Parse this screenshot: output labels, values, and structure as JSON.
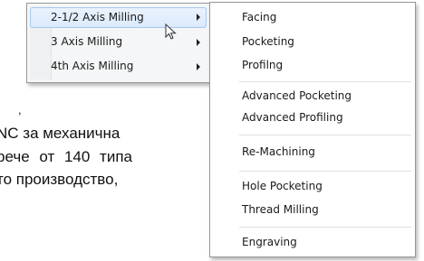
{
  "document": {
    "lines": [
      ",",
      "NC за механична",
      "рече от 140 типа",
      "то производство,"
    ]
  },
  "menu_left": {
    "items": [
      {
        "label": "2-1/2 Axis Milling",
        "has_submenu": true,
        "highlighted": true
      },
      {
        "label": "3 Axis Milling",
        "has_submenu": true,
        "highlighted": false
      },
      {
        "label": "4th Axis Milling",
        "has_submenu": true,
        "highlighted": false
      }
    ]
  },
  "menu_right": {
    "items": [
      {
        "label": "Facing"
      },
      {
        "label": "Pocketing"
      },
      {
        "label": "Profilng"
      },
      {
        "label": "Advanced Pocketing"
      },
      {
        "label": "Advanced Profiling"
      },
      {
        "label": "Re-Machining"
      },
      {
        "label": "Hole Pocketing"
      },
      {
        "label": "Thread Milling"
      },
      {
        "label": "Engraving"
      }
    ]
  },
  "colors": {
    "menu_background": "#f5f6f7",
    "highlight": "#dbeafc",
    "highlight_border": "#a9c7ee",
    "border": "#979797"
  },
  "icons": {
    "submenu_arrow": "triangle-right-icon",
    "pointer": "mouse-cursor-icon"
  }
}
